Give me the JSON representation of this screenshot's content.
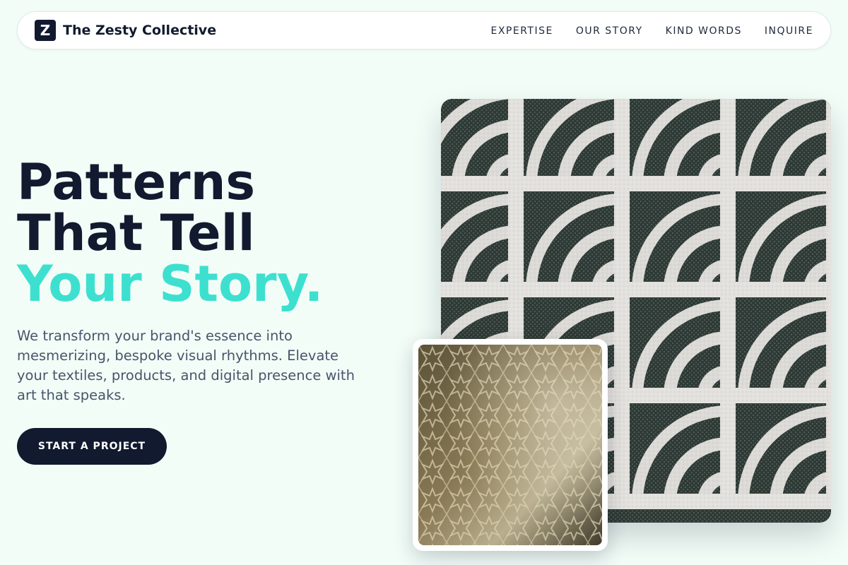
{
  "brand": {
    "logo_letter": "Z",
    "name": "The Zesty Collective"
  },
  "nav": {
    "items": [
      {
        "label": "EXPERTISE"
      },
      {
        "label": "OUR STORY"
      },
      {
        "label": "KIND WORDS"
      },
      {
        "label": "INQUIRE"
      }
    ]
  },
  "hero": {
    "headline_line1": "Patterns",
    "headline_line2": "That Tell",
    "headline_accent": "Your Story.",
    "description": "We transform your brand's essence into mesmerizing, bespoke visual rhythms. Elevate your textiles, products, and digital presence with art that speaks.",
    "cta_label": "START A PROJECT"
  },
  "images": {
    "main": "concrete-breeze-block-pattern",
    "inset": "brass-geometric-star-pattern"
  },
  "colors": {
    "navy": "#111a2e",
    "accent": "#3de0cf",
    "background": "#f2fdf8",
    "body_text": "#475569"
  }
}
